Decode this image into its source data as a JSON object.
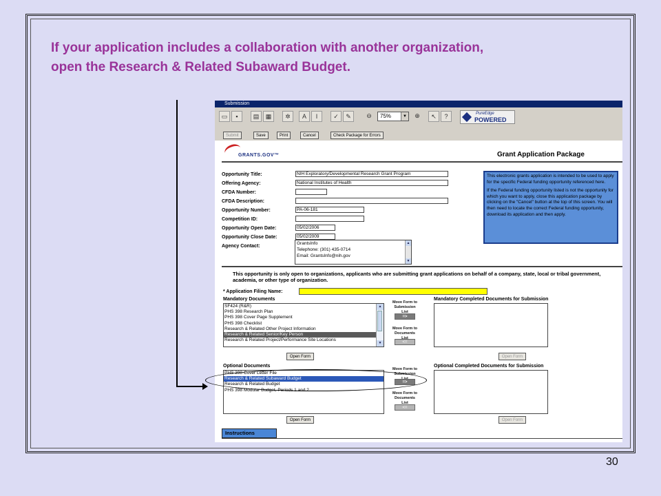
{
  "slide": {
    "title_line1": "If your application includes a collaboration with another organization,",
    "title_line2": "open the Research & Related Subaward Budget.",
    "number": "30"
  },
  "window": {
    "title": "Submission"
  },
  "toolbar": {
    "zoom_value": "75%",
    "zoom_in": "⊕",
    "zoom_out": "⊖",
    "pe_logo_top": "PureEdge",
    "pe_logo_bottom": "POWERED",
    "icons": [
      "open-icon",
      "save-icon",
      "print-icon",
      "fax-icon",
      "settings-icon",
      "font-icon",
      "text-icon",
      "check-icon",
      "signature-icon",
      "zoom-out-icon",
      "zoom-in-icon",
      "pointer-help-icon",
      "help-icon"
    ]
  },
  "actions": {
    "submit": "Submit",
    "save": "Save",
    "print": "Print",
    "cancel": "Cancel",
    "check": "Check Package for Errors"
  },
  "header": {
    "logo_text": "GRANTS.GOV™",
    "package_title": "Grant Application Package"
  },
  "fields": {
    "opportunity_title": {
      "label": "Opportunity Title:",
      "value": "NIH Exploratory/Developmental Research Grant Program"
    },
    "offering_agency": {
      "label": "Offering Agency:",
      "value": "National Institutes of Health"
    },
    "cfda_number": {
      "label": "CFDA Number:",
      "value": ""
    },
    "cfda_description": {
      "label": "CFDA Description:",
      "value": ""
    },
    "opportunity_number": {
      "label": "Opportunity Number:",
      "value": "PA-06-181"
    },
    "competition_id": {
      "label": "Competition ID:",
      "value": ""
    },
    "open_date": {
      "label": "Opportunity Open Date:",
      "value": "05/02/2006"
    },
    "close_date": {
      "label": "Opportunity Close Date:",
      "value": "05/02/2009"
    },
    "agency_contact": {
      "label": "Agency Contact:",
      "line1": "GrantsInfo",
      "line2": "Telephone: (301) 435-0714",
      "line3": "Email:  GrantsInfo@nih.gov"
    }
  },
  "info_box": {
    "para1": "This electronic grants application is intended to be used to apply for the specific Federal funding opportunity referenced here.",
    "para2": "If the Federal funding opportunity listed is not the opportunity for which you want to apply, close this application package by clicking on the \"Cancel\" button at the top of this screen. You will then need to locate the correct Federal funding opportunity, download its application and then apply."
  },
  "notice": "This opportunity is only open to organizations, applicants who are submitting grant applications on behalf of a company, state, local or tribal government, academia, or other type of organization.",
  "filing": {
    "label": "* Application Filing Name:",
    "value": ""
  },
  "mandatory": {
    "title": "Mandatory Documents",
    "items": [
      "SF424 (R&R)",
      "PHS 398 Research Plan",
      "PHS 398 Cover Page Supplement",
      "PHS 398 Checklist",
      "Research & Related Other Project Information",
      "Research & Related Senior/Key Person",
      "Research & Related Project/Performance Site Locations"
    ],
    "completed_title": "Mandatory Completed Documents for Submission"
  },
  "optional": {
    "title": "Optional Documents",
    "items": [
      "PHS 398 Cover Letter File",
      "Research & Related Subaward Budget",
      "Research & Related Budget",
      "PHS 398 Modular Budget, Periods 1 and 2"
    ],
    "completed_title": "Optional Completed Documents for Submission"
  },
  "move": {
    "to_submission": "Move Form to Submission List",
    "to_documents": "Move Form to Documents List",
    "add_arrow": "=>",
    "remove_arrow": "<="
  },
  "open_form": "Open Form",
  "instructions": "Instructions"
}
